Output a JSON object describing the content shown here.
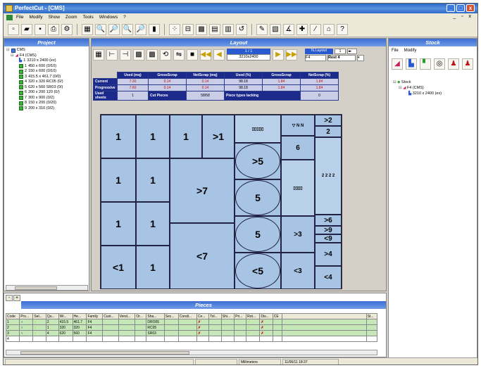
{
  "window": {
    "title": "PerfectCut - [CMS]"
  },
  "menu": {
    "items": [
      "File",
      "Modify",
      "Show",
      "Zoom",
      "Tools",
      "Windows",
      "?"
    ]
  },
  "project": {
    "title": "Project",
    "root": "CMS",
    "group": "F4 (CMS)",
    "items": [
      {
        "n": "1",
        "label": "3210 x 2400 (ex)"
      },
      {
        "n": "1",
        "label": "450 x 600 (0/10)"
      },
      {
        "n": "2",
        "label": "150 x 600 (0/10)"
      },
      {
        "n": "3",
        "label": "415.5 x 461.7 (0/0)"
      },
      {
        "n": "4",
        "label": "320 x 320 RC05 (0/)"
      },
      {
        "n": "5",
        "label": "620 x 560 SR03 (0/)"
      },
      {
        "n": "6",
        "label": "200 x 200 120 (0/)"
      },
      {
        "n": "7",
        "label": "300 x 900 (0/2)"
      },
      {
        "n": "8",
        "label": "150 x 200 (0/20)"
      },
      {
        "n": "9",
        "label": "200 x 310 (0/2)"
      }
    ]
  },
  "layout": {
    "title": "Layout",
    "sheet_counter": "1 / 1",
    "sheet_size": "3210x2400",
    "sheet_name": "F4",
    "n_layout_label": "N.Layout",
    "n_layout_value": "1",
    "rest": "Rest 4",
    "stats_headers": [
      "Used (mq)",
      "GrossScrap",
      "NetScrap (mq)",
      "Used (%)",
      "GrossScrap",
      "NetScrap (%)"
    ],
    "rows": [
      {
        "label": "Current",
        "values": [
          "7.30",
          "0.14",
          "0.14",
          "98.18",
          "1.84",
          "1.84"
        ]
      },
      {
        "label": "Progressive",
        "values": [
          "7.60",
          "0.14",
          "0.14",
          "98.18",
          "1.84",
          "1.84"
        ]
      }
    ],
    "used_sheets_label": "Used sheets",
    "used_sheets_value": "1",
    "cut_pieces_label": "Cut Pieces",
    "cut_pieces_value": "58/58",
    "piece_types_label": "Piece types lacking",
    "piece_types_value": "0",
    "pieces": {
      "p1": "1",
      "p2": "1",
      "p3": "1",
      "p4": ">1",
      "p5": "1",
      "p6": "1",
      "p7": ">7",
      "p8": "1",
      "p9": "1",
      "p10": "<1",
      "p11": "1",
      "p12": "<7",
      "c1": ">5",
      "c2": "5",
      "c3": "5",
      "c4": "<5",
      "p13": ">3",
      "p14": "<3",
      "p15": "6",
      "p16": ">2",
      "p17": "2",
      "p18": ">4",
      "p19": "<4",
      "p20": ">6",
      "p21": ">9",
      "p22": "<9"
    }
  },
  "stock": {
    "title": "Stock",
    "menu": [
      "File",
      "Modify"
    ],
    "root": "Stock",
    "group": "F4 (CMS)",
    "item": "3210 x 2400 (ex)"
  },
  "pieces_panel": {
    "title": "Pieces",
    "headers": [
      "Code",
      "Pro...",
      "Sel...",
      "Qu...",
      "Wi...",
      "He...",
      "Family",
      "Cust...",
      "Vend...",
      "Or...",
      "Sha...",
      "Sec...",
      "Condi...",
      "Ce...",
      "Tol...",
      "Shi...",
      "Pri...",
      "Rot...",
      "Dis...",
      "CE",
      "",
      "St..."
    ],
    "rows": [
      {
        "code": "1",
        "qty": "2",
        "w": "415.5",
        "h": "461.7",
        "fam": "F4",
        "sha": "DRO05"
      },
      {
        "code": "2",
        "qty": "1",
        "w": "320",
        "h": "320",
        "fam": "F4",
        "sha": "RC05"
      },
      {
        "code": "3",
        "qty": "4",
        "w": "620",
        "h": "560",
        "fam": "F4",
        "sha": "SR03"
      },
      {
        "code": "4",
        "qty": "",
        "w": "",
        "h": "",
        "fam": "",
        "sha": ""
      }
    ]
  },
  "status": {
    "unit": "Millimeters",
    "datetime": "11/06/11  18:37"
  }
}
